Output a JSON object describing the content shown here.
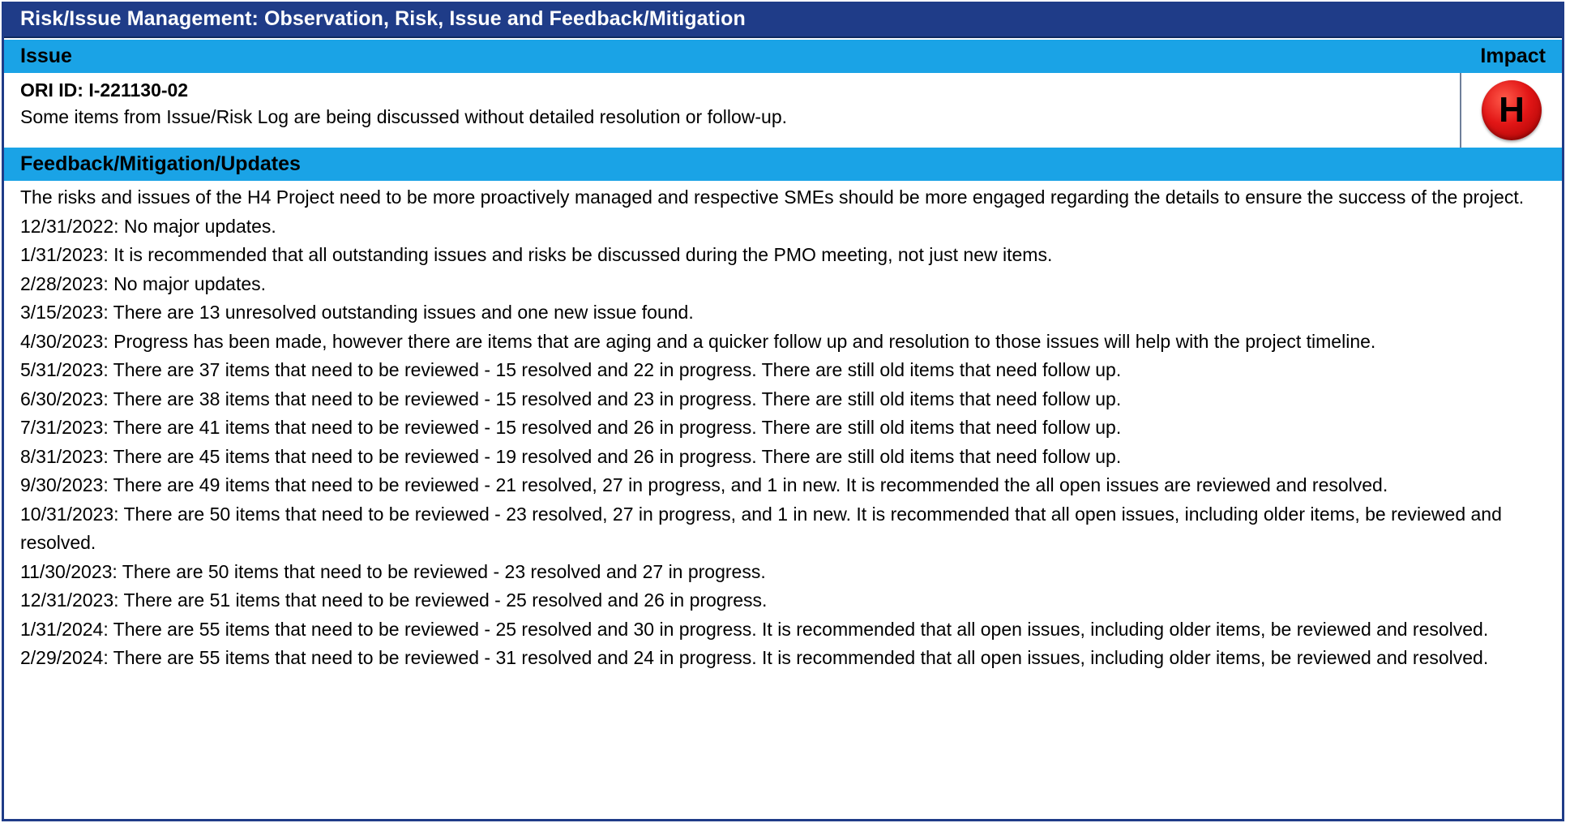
{
  "title": "Risk/Issue Management: Observation, Risk, Issue and Feedback/Mitigation",
  "issue_header": {
    "label": "Issue",
    "impact_label": "Impact"
  },
  "issue": {
    "ori_id": "ORI ID: I-221130-02",
    "description": "Some items from Issue/Risk Log are being discussed without detailed resolution or follow-up.",
    "impact_letter": "H",
    "impact_color": "#e21616"
  },
  "feedback_header": {
    "label": "Feedback/Mitigation/Updates"
  },
  "feedback": {
    "intro": "The risks and issues of the H4 Project need to be more proactively managed and respective SMEs should be more engaged regarding the details to ensure the success of the project.",
    "updates": [
      "12/31/2022: No major updates.",
      "1/31/2023: It is recommended that all outstanding issues and risks be discussed during the PMO meeting, not just new items.",
      "2/28/2023: No major updates.",
      "3/15/2023: There are 13 unresolved outstanding issues and one new issue found.",
      "4/30/2023: Progress has been made, however there are items that are aging and a quicker follow up and resolution to those issues will help with the project timeline.",
      "5/31/2023: There are 37 items that need to be reviewed  - 15 resolved and 22 in progress.  There are still old items that need follow up.",
      "6/30/2023: There are 38 items that need to be reviewed  - 15 resolved and 23 in progress.  There are still old items that need follow up.",
      "7/31/2023: There are 41 items that need to be reviewed  - 15 resolved and 26 in progress.  There are still old items that need follow up.",
      "8/31/2023: There are 45 items that need to be reviewed  - 19 resolved and 26 in progress.  There are still old items that need follow up.",
      "9/30/2023: There are 49 items that need to be reviewed  - 21 resolved, 27 in progress, and 1 in new.  It is recommended the all open issues are reviewed and resolved.",
      "10/31/2023: There are 50 items that need to be reviewed  - 23 resolved, 27 in progress, and 1 in new.  It is recommended that all open issues, including older items, be reviewed and resolved.",
      "11/30/2023: There are 50 items that need to be reviewed  - 23 resolved and 27 in progress.",
      "12/31/2023: There are 51 items that need to be reviewed  - 25 resolved and 26 in progress.",
      "1/31/2024: There are 55 items that need to be reviewed  - 25 resolved and 30 in progress. It is recommended that all open issues, including older items, be reviewed and resolved.",
      "2/29/2024: There are 55 items that need to be reviewed  - 31 resolved and 24 in progress. It is recommended that all open issues, including older items, be reviewed and resolved."
    ]
  }
}
